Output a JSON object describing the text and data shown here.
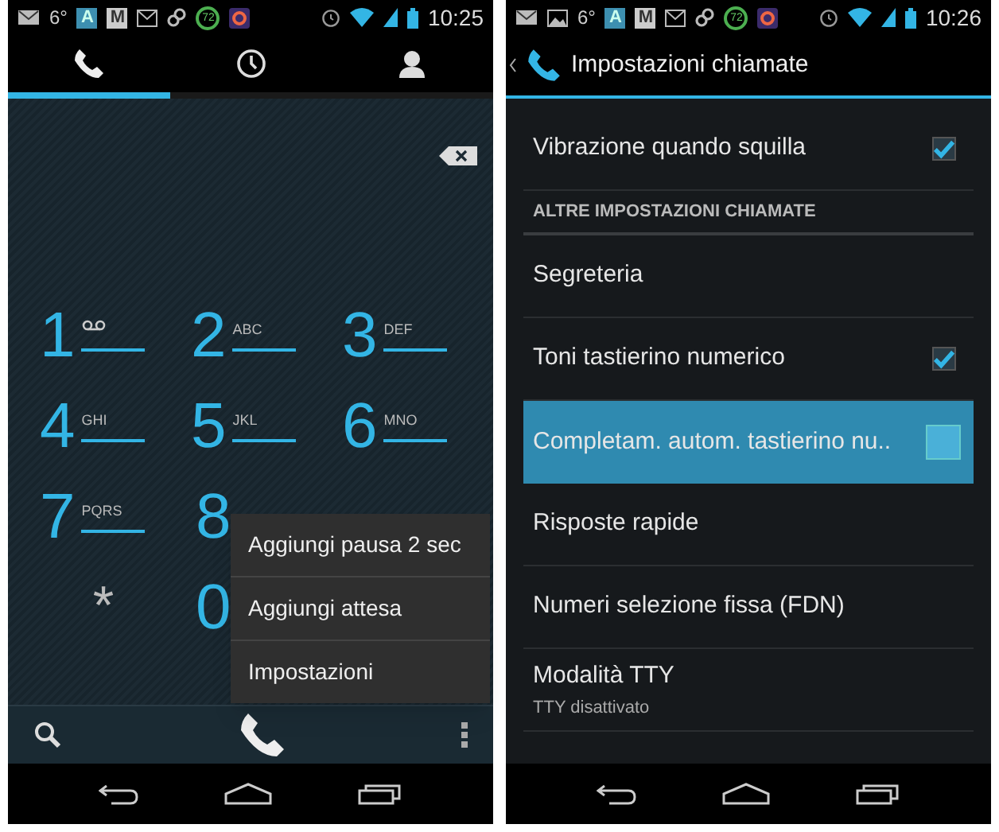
{
  "dialer": {
    "status_bar": {
      "notifications": [
        {
          "kind": "mail"
        },
        {
          "kind": "text",
          "text": "6°"
        },
        {
          "kind": "app-a",
          "text": "A"
        },
        {
          "kind": "app-m",
          "text": "M"
        },
        {
          "kind": "gmail"
        },
        {
          "kind": "link"
        },
        {
          "kind": "ring",
          "text": "72"
        },
        {
          "kind": "app"
        }
      ],
      "time": "10:25"
    },
    "tabs": [
      {
        "kind": "phone",
        "selected": true
      },
      {
        "kind": "clock",
        "selected": false
      },
      {
        "kind": "contacts",
        "selected": false
      }
    ],
    "keypad": [
      [
        {
          "digit": "1",
          "kind": "voicemail"
        },
        {
          "digit": "2",
          "letters": "ABC"
        },
        {
          "digit": "3",
          "letters": "DEF"
        }
      ],
      [
        {
          "digit": "4",
          "letters": "GHI"
        },
        {
          "digit": "5",
          "letters": "JKL"
        },
        {
          "digit": "6",
          "letters": "MNO"
        }
      ],
      [
        {
          "digit": "7",
          "letters": "PQRS"
        },
        {
          "digit": "8",
          "kind": "plain"
        }
      ],
      [
        {
          "digit": "*",
          "kind": "symbol"
        },
        {
          "digit": "0",
          "kind": "plain"
        }
      ]
    ],
    "menu": [
      "Aggiungi pausa 2 sec",
      "Aggiungi attesa",
      "Impostazioni"
    ]
  },
  "settings": {
    "status_bar": {
      "notifications": [
        {
          "kind": "mail"
        },
        {
          "kind": "gallery"
        },
        {
          "kind": "text",
          "text": "6°"
        },
        {
          "kind": "app-a",
          "text": "A"
        },
        {
          "kind": "app-m",
          "text": "M"
        },
        {
          "kind": "gmail"
        },
        {
          "kind": "link"
        },
        {
          "kind": "ring",
          "text": "72"
        },
        {
          "kind": "app"
        }
      ],
      "time": "10:26"
    },
    "title": "Impostazioni chiamate",
    "items": [
      {
        "kind": "checkbox",
        "label": "Vibrazione quando squilla",
        "checked": true,
        "pressed": false
      },
      {
        "kind": "header",
        "label": "ALTRE IMPOSTAZIONI CHIAMATE"
      },
      {
        "kind": "plain",
        "label": "Segreteria",
        "pressed": false
      },
      {
        "kind": "checkbox",
        "label": "Toni tastierino numerico",
        "checked": true,
        "pressed": false
      },
      {
        "kind": "checkbox",
        "label": "Completam. autom. tastierino nu..",
        "checked": false,
        "pressed": true
      },
      {
        "kind": "plain",
        "label": "Risposte rapide",
        "pressed": false
      },
      {
        "kind": "plain",
        "label": "Numeri selezione fissa (FDN)",
        "pressed": false
      },
      {
        "kind": "plain",
        "label": "Modalità TTY",
        "summary": "TTY disattivato",
        "pressed": false
      }
    ]
  }
}
